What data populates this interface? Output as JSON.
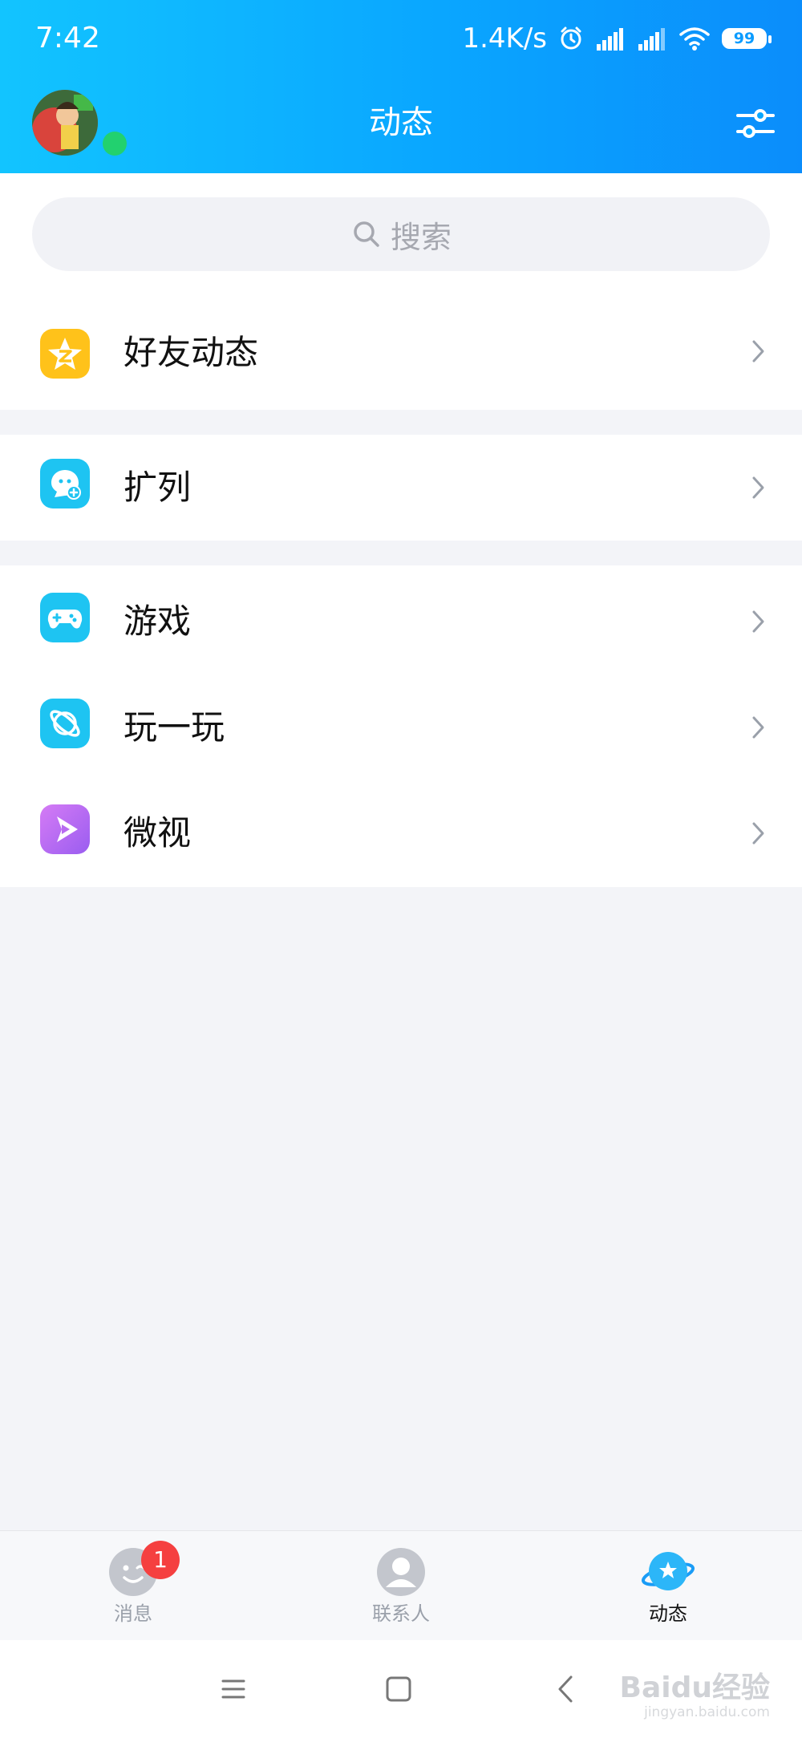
{
  "status_bar": {
    "time": "7:42",
    "net_speed": "1.4K/s",
    "battery": "99"
  },
  "header": {
    "title": "动态"
  },
  "search": {
    "placeholder": "搜索"
  },
  "sections": [
    {
      "items": [
        {
          "label": "好友动态",
          "icon": "qzone-star-icon",
          "color": "#ffc21a"
        }
      ]
    },
    {
      "items": [
        {
          "label": "扩列",
          "icon": "add-friend-bubble-icon",
          "color": "#1ec4f2"
        }
      ]
    },
    {
      "items": [
        {
          "label": "游戏",
          "icon": "gamepad-icon",
          "color": "#1ec4f2"
        },
        {
          "label": "玩一玩",
          "icon": "planet-icon",
          "color": "#1ec4f2"
        },
        {
          "label": "微视",
          "icon": "play-icon",
          "color": "#b86cf0"
        }
      ]
    }
  ],
  "tabbar": {
    "tabs": [
      {
        "label": "消息",
        "badge": "1",
        "icon": "message-face-icon"
      },
      {
        "label": "联系人",
        "icon": "contacts-person-icon"
      },
      {
        "label": "动态",
        "icon": "planet-star-icon",
        "active": true
      }
    ]
  },
  "watermark": {
    "brand": "Baidu经验",
    "url": "jingyan.baidu.com"
  },
  "colors": {
    "header_start": "#12c4ff",
    "header_end": "#0b8dfb",
    "badge": "#f54040",
    "online": "#22d16f"
  }
}
